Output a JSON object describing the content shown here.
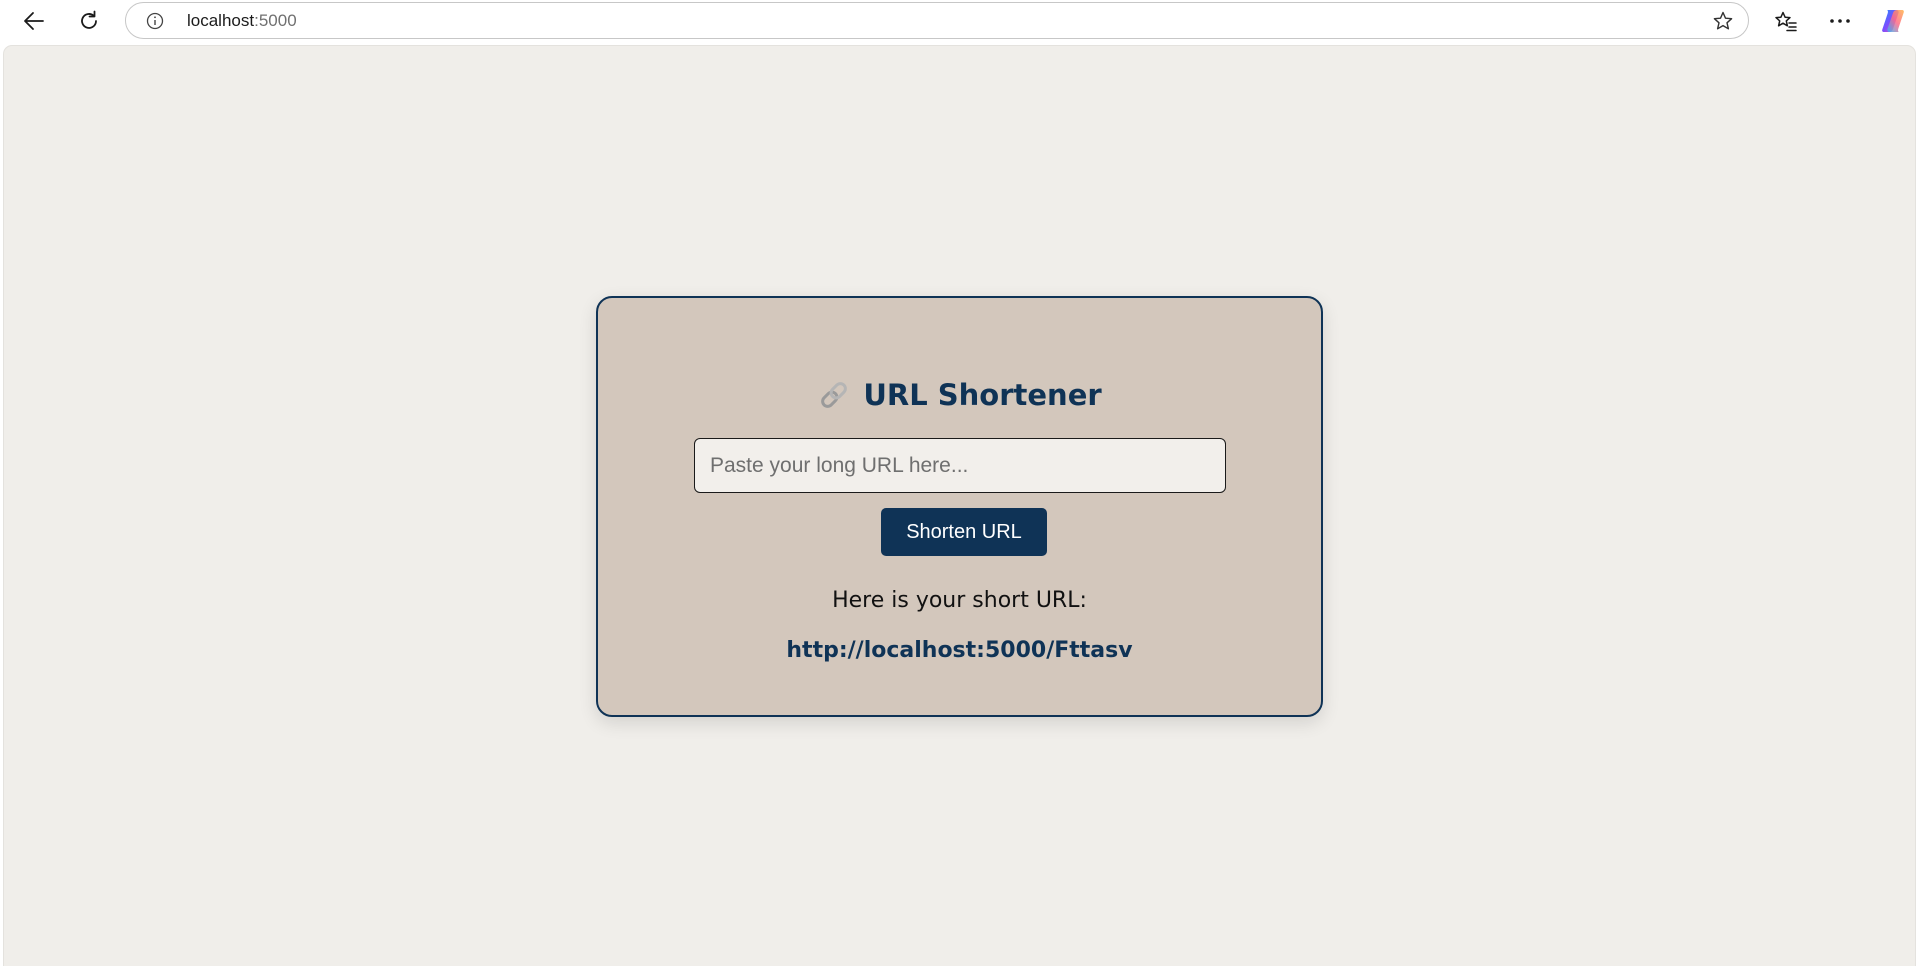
{
  "browser": {
    "address_host": "localhost",
    "address_port": ":5000",
    "icons": {
      "back": "back-arrow-icon",
      "reload": "reload-icon",
      "info": "info-icon",
      "favorite": "star-icon",
      "favorites_list": "favorites-icon",
      "more": "more-icon",
      "copilot": "copilot-icon"
    }
  },
  "app": {
    "title": "URL Shortener",
    "title_icon": "link-icon",
    "input_placeholder": "Paste your long URL here...",
    "input_value": "",
    "button_label": "Shorten URL",
    "result_label": "Here is your short URL:",
    "short_url": "http://localhost:5000/Fttasv"
  },
  "colors": {
    "page_bg": "#f0eeea",
    "card_bg": "#d3c7bc",
    "accent": "#0f3356"
  }
}
